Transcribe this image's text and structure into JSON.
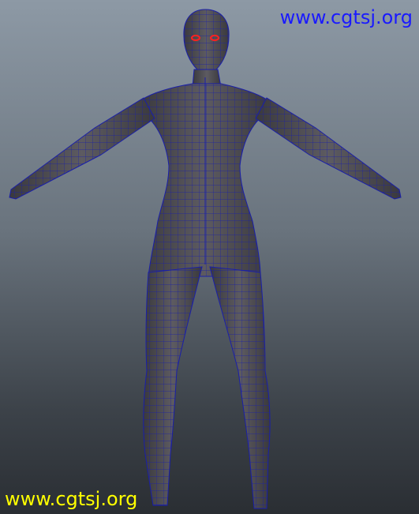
{
  "viewport": {
    "background_top": "#8d99a5",
    "background_bottom": "#2a2e33"
  },
  "model": {
    "icon": "humanoid-wireframe-mesh",
    "shaded_color": "#4f4d52",
    "wire_color": "#1a1fa8",
    "eye_color": "#ff2020"
  },
  "watermarks": {
    "top_text": "www.cgtsj.org",
    "top_color": "#1a1aff",
    "bottom_text": "www.cgtsj.org",
    "bottom_color": "#ffff00"
  }
}
